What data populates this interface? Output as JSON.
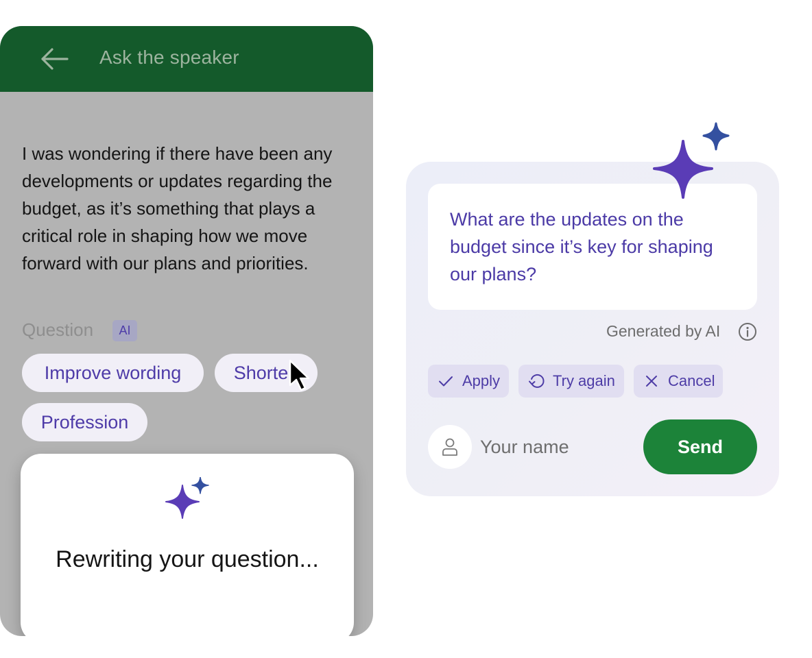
{
  "header": {
    "title": "Ask the speaker",
    "back_icon": "arrow-left-icon"
  },
  "question": {
    "text": "I was wondering if there have been any developments or updates regarding the budget, as it’s something that plays a critical role in shaping how we move forward with our plans and priorities.",
    "label": "Question",
    "ai_badge": "AI"
  },
  "chips": {
    "improve": "Improve wording",
    "shorten": "Shorten",
    "profession": "Profession"
  },
  "loading": {
    "text": "Rewriting your question...",
    "icon": "sparkle-icon"
  },
  "suggestion": {
    "text": "What are the updates on the budget since it’s key for shaping our plans?",
    "generated_label": "Generated by AI",
    "info_icon": "info-icon"
  },
  "actions": {
    "apply": "Apply",
    "try_again": "Try again",
    "cancel": "Cancel"
  },
  "form": {
    "name_placeholder": "Your name",
    "send": "Send",
    "avatar_icon": "user-icon"
  },
  "colors": {
    "header_green": "#145a2b",
    "overlay_gray": "#b3b3b3",
    "accent_purple": "#4b3aa6",
    "send_green": "#1c8339",
    "sparkle_purple": "#5a3cb6",
    "sparkle_blue": "#3450a0"
  }
}
